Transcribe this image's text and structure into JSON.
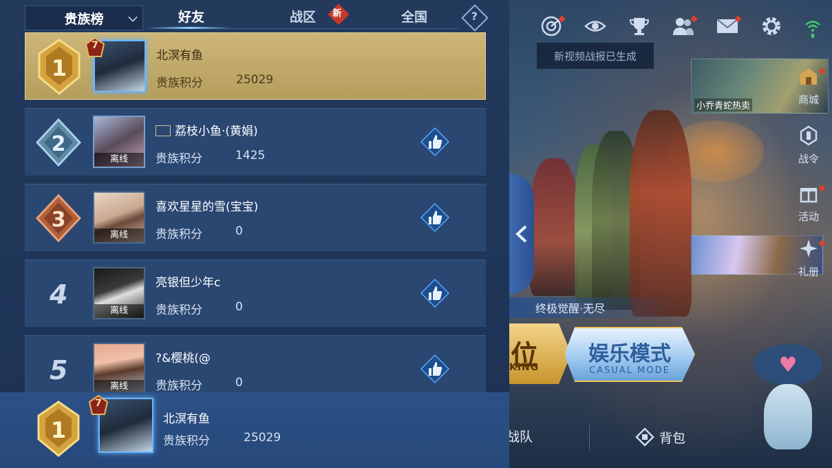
{
  "tabs": {
    "dropdown_label": "贵族榜",
    "friends": "好友",
    "region": "战区",
    "new_badge": "新",
    "national": "全国",
    "help": "?"
  },
  "leaderboard": [
    {
      "rank": "1",
      "name": "北溟有鱼",
      "score_label": "贵族积分",
      "score": "25029",
      "level": "7",
      "offline": "",
      "is_me": true
    },
    {
      "rank": "2",
      "name": "荔枝小鱼·(黄娟)",
      "score_label": "贵族积分",
      "score": "1425",
      "level": "",
      "offline": "离线",
      "is_me": false
    },
    {
      "rank": "3",
      "name": "喜欢星星的雪(宝宝)",
      "score_label": "贵族积分",
      "score": "0",
      "level": "",
      "offline": "离线",
      "is_me": false
    },
    {
      "rank": "4",
      "name": "亮银但少年c",
      "score_label": "贵族积分",
      "score": "0",
      "level": "",
      "offline": "离线",
      "is_me": false
    },
    {
      "rank": "5",
      "name": "?&樱桃(@",
      "score_label": "贵族积分",
      "score": "0",
      "level": "",
      "offline": "离线",
      "is_me": false
    }
  ],
  "my_rank": {
    "rank": "1",
    "name": "北溟有鱼",
    "score_label": "贵族积分",
    "score": "25029",
    "level": "7"
  },
  "lobby": {
    "notice": "新视频战报已生成",
    "promo_hero": "小乔青蛇热卖",
    "side": {
      "shop": "商城",
      "pass": "战令",
      "events": "活动",
      "gift": "礼册"
    },
    "mode_banner": "终极觉醒·无尽",
    "rank_btn_big": "位",
    "rank_btn_small": "KING",
    "casual_cn": "娱乐模式",
    "casual_en": "CASUAL MODE",
    "bottom": {
      "team": "战队",
      "bag": "背包"
    },
    "mascot_heart": "♥"
  },
  "colors": {
    "gold_row": "#cdb679",
    "row": "#2a4772",
    "accent": "#8fd0ff",
    "badge_red": "#c6392a"
  },
  "icons": [
    "radar-icon",
    "eye-icon",
    "trophy-icon",
    "friends-icon",
    "mail-icon",
    "gear-icon",
    "wifi-icon",
    "thumbs-up-icon",
    "chevron-left-icon",
    "help-icon"
  ]
}
